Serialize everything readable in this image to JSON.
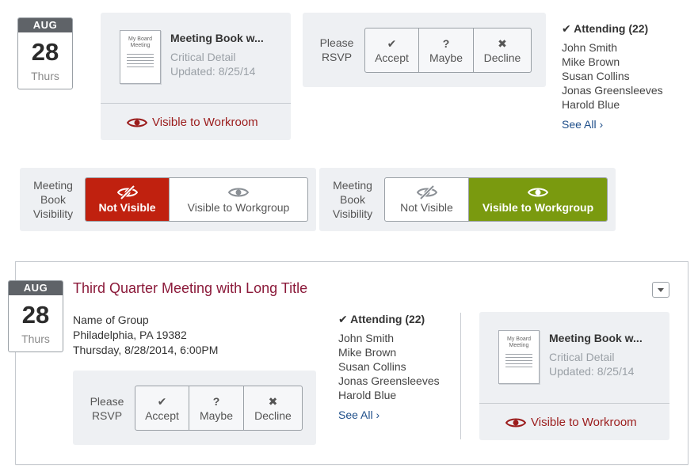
{
  "top": {
    "date": {
      "month": "AUG",
      "day": "28",
      "weekday": "Thurs"
    },
    "book": {
      "icon_text": "My Board Meeting",
      "title": "Meeting Book w...",
      "detail": "Critical Detail",
      "updated": "Updated: 8/25/14",
      "visibility": "Visible to Workroom"
    },
    "rsvp": {
      "label_line1": "Please",
      "label_line2": "RSVP",
      "accept": "Accept",
      "maybe": "Maybe",
      "decline": "Decline"
    },
    "attending": {
      "heading": "Attending (22)",
      "names": [
        "John Smith",
        "Mike Brown",
        "Susan Collins",
        "Jonas Greensleeves",
        "Harold Blue"
      ],
      "see_all": "See All ›"
    }
  },
  "visibility_toggles": [
    {
      "label_lines": [
        "Meeting",
        "Book",
        "Visibility"
      ],
      "not_visible": "Not Visible",
      "visible_workgroup": "Visible to Workgroup",
      "selected": "not_visible",
      "selected_color": "#c0210f"
    },
    {
      "label_lines": [
        "Meeting",
        "Book",
        "Visibility"
      ],
      "not_visible": "Not Visible",
      "visible_workgroup": "Visible to Workgroup",
      "selected": "visible_workgroup",
      "selected_color": "#7a9a0f"
    }
  ],
  "card": {
    "date": {
      "month": "AUG",
      "day": "28",
      "weekday": "Thurs"
    },
    "title": "Third Quarter Meeting with Long Title",
    "group": "Name of Group",
    "location": "Philadelphia, PA 19382",
    "datetime": "Thursday, 8/28/2014, 6:00PM",
    "rsvp": {
      "label_line1": "Please",
      "label_line2": "RSVP",
      "accept": "Accept",
      "maybe": "Maybe",
      "decline": "Decline"
    },
    "attending": {
      "heading": "Attending (22)",
      "names": [
        "John Smith",
        "Mike Brown",
        "Susan Collins",
        "Jonas Greensleeves",
        "Harold Blue"
      ],
      "see_all": "See All ›"
    },
    "book": {
      "icon_text": "My Board Meeting",
      "title": "Meeting Book w...",
      "detail": "Critical Detail",
      "updated": "Updated: 8/25/14",
      "visibility": "Visible to Workroom"
    }
  },
  "colors": {
    "title": "#8b1a3a",
    "link": "#1f4f8a",
    "visible_workroom": "#9b1c1c",
    "not_visible_bg": "#c0210f",
    "visible_workgroup_bg": "#7a9a0f"
  },
  "icons": {
    "checkmark": "check-icon",
    "question": "question-icon",
    "decline": "x-icon",
    "eye": "eye-icon",
    "eye_slash": "eye-slash-icon",
    "document": "document-icon",
    "dropdown": "chevron-down-icon"
  }
}
